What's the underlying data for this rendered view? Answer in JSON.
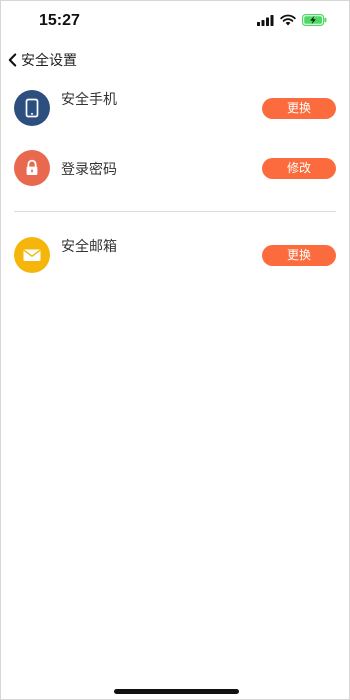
{
  "status_bar": {
    "time": "15:27"
  },
  "nav": {
    "title": "安全设置"
  },
  "items": [
    {
      "label": "安全手机",
      "action": "更换",
      "icon": "phone-icon",
      "icon_color": "#2c4f7f"
    },
    {
      "label": "登录密码",
      "action": "修改",
      "icon": "lock-icon",
      "icon_color": "#e8694e"
    },
    {
      "label": "安全邮箱",
      "action": "更换",
      "icon": "mail-icon",
      "icon_color": "#f5b50a"
    }
  ],
  "colors": {
    "accent": "#fb6b3d",
    "battery": "#4cd964"
  }
}
